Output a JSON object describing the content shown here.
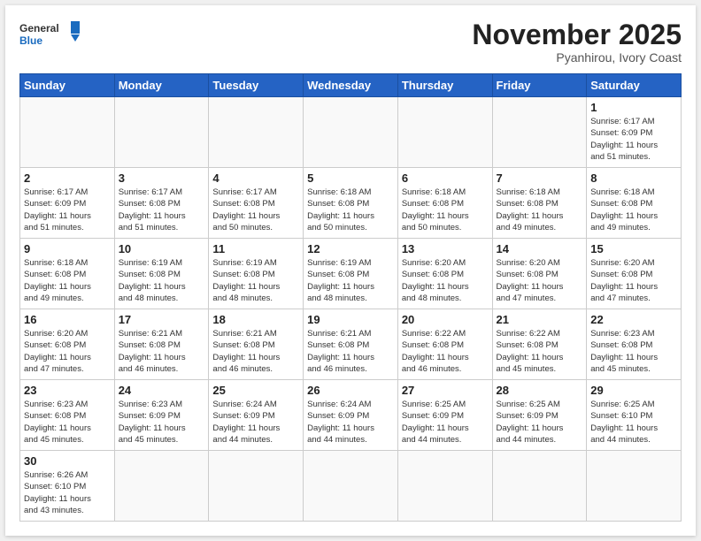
{
  "header": {
    "logo_general": "General",
    "logo_blue": "Blue",
    "month_title": "November 2025",
    "subtitle": "Pyanhirou, Ivory Coast"
  },
  "weekdays": [
    "Sunday",
    "Monday",
    "Tuesday",
    "Wednesday",
    "Thursday",
    "Friday",
    "Saturday"
  ],
  "weeks": [
    [
      {
        "day": "",
        "info": ""
      },
      {
        "day": "",
        "info": ""
      },
      {
        "day": "",
        "info": ""
      },
      {
        "day": "",
        "info": ""
      },
      {
        "day": "",
        "info": ""
      },
      {
        "day": "",
        "info": ""
      },
      {
        "day": "1",
        "info": "Sunrise: 6:17 AM\nSunset: 6:09 PM\nDaylight: 11 hours\nand 51 minutes."
      }
    ],
    [
      {
        "day": "2",
        "info": "Sunrise: 6:17 AM\nSunset: 6:09 PM\nDaylight: 11 hours\nand 51 minutes."
      },
      {
        "day": "3",
        "info": "Sunrise: 6:17 AM\nSunset: 6:08 PM\nDaylight: 11 hours\nand 51 minutes."
      },
      {
        "day": "4",
        "info": "Sunrise: 6:17 AM\nSunset: 6:08 PM\nDaylight: 11 hours\nand 50 minutes."
      },
      {
        "day": "5",
        "info": "Sunrise: 6:18 AM\nSunset: 6:08 PM\nDaylight: 11 hours\nand 50 minutes."
      },
      {
        "day": "6",
        "info": "Sunrise: 6:18 AM\nSunset: 6:08 PM\nDaylight: 11 hours\nand 50 minutes."
      },
      {
        "day": "7",
        "info": "Sunrise: 6:18 AM\nSunset: 6:08 PM\nDaylight: 11 hours\nand 49 minutes."
      },
      {
        "day": "8",
        "info": "Sunrise: 6:18 AM\nSunset: 6:08 PM\nDaylight: 11 hours\nand 49 minutes."
      }
    ],
    [
      {
        "day": "9",
        "info": "Sunrise: 6:18 AM\nSunset: 6:08 PM\nDaylight: 11 hours\nand 49 minutes."
      },
      {
        "day": "10",
        "info": "Sunrise: 6:19 AM\nSunset: 6:08 PM\nDaylight: 11 hours\nand 48 minutes."
      },
      {
        "day": "11",
        "info": "Sunrise: 6:19 AM\nSunset: 6:08 PM\nDaylight: 11 hours\nand 48 minutes."
      },
      {
        "day": "12",
        "info": "Sunrise: 6:19 AM\nSunset: 6:08 PM\nDaylight: 11 hours\nand 48 minutes."
      },
      {
        "day": "13",
        "info": "Sunrise: 6:20 AM\nSunset: 6:08 PM\nDaylight: 11 hours\nand 48 minutes."
      },
      {
        "day": "14",
        "info": "Sunrise: 6:20 AM\nSunset: 6:08 PM\nDaylight: 11 hours\nand 47 minutes."
      },
      {
        "day": "15",
        "info": "Sunrise: 6:20 AM\nSunset: 6:08 PM\nDaylight: 11 hours\nand 47 minutes."
      }
    ],
    [
      {
        "day": "16",
        "info": "Sunrise: 6:20 AM\nSunset: 6:08 PM\nDaylight: 11 hours\nand 47 minutes."
      },
      {
        "day": "17",
        "info": "Sunrise: 6:21 AM\nSunset: 6:08 PM\nDaylight: 11 hours\nand 46 minutes."
      },
      {
        "day": "18",
        "info": "Sunrise: 6:21 AM\nSunset: 6:08 PM\nDaylight: 11 hours\nand 46 minutes."
      },
      {
        "day": "19",
        "info": "Sunrise: 6:21 AM\nSunset: 6:08 PM\nDaylight: 11 hours\nand 46 minutes."
      },
      {
        "day": "20",
        "info": "Sunrise: 6:22 AM\nSunset: 6:08 PM\nDaylight: 11 hours\nand 46 minutes."
      },
      {
        "day": "21",
        "info": "Sunrise: 6:22 AM\nSunset: 6:08 PM\nDaylight: 11 hours\nand 45 minutes."
      },
      {
        "day": "22",
        "info": "Sunrise: 6:23 AM\nSunset: 6:08 PM\nDaylight: 11 hours\nand 45 minutes."
      }
    ],
    [
      {
        "day": "23",
        "info": "Sunrise: 6:23 AM\nSunset: 6:08 PM\nDaylight: 11 hours\nand 45 minutes."
      },
      {
        "day": "24",
        "info": "Sunrise: 6:23 AM\nSunset: 6:09 PM\nDaylight: 11 hours\nand 45 minutes."
      },
      {
        "day": "25",
        "info": "Sunrise: 6:24 AM\nSunset: 6:09 PM\nDaylight: 11 hours\nand 44 minutes."
      },
      {
        "day": "26",
        "info": "Sunrise: 6:24 AM\nSunset: 6:09 PM\nDaylight: 11 hours\nand 44 minutes."
      },
      {
        "day": "27",
        "info": "Sunrise: 6:25 AM\nSunset: 6:09 PM\nDaylight: 11 hours\nand 44 minutes."
      },
      {
        "day": "28",
        "info": "Sunrise: 6:25 AM\nSunset: 6:09 PM\nDaylight: 11 hours\nand 44 minutes."
      },
      {
        "day": "29",
        "info": "Sunrise: 6:25 AM\nSunset: 6:10 PM\nDaylight: 11 hours\nand 44 minutes."
      }
    ],
    [
      {
        "day": "30",
        "info": "Sunrise: 6:26 AM\nSunset: 6:10 PM\nDaylight: 11 hours\nand 43 minutes."
      },
      {
        "day": "",
        "info": ""
      },
      {
        "day": "",
        "info": ""
      },
      {
        "day": "",
        "info": ""
      },
      {
        "day": "",
        "info": ""
      },
      {
        "day": "",
        "info": ""
      },
      {
        "day": "",
        "info": ""
      }
    ]
  ]
}
